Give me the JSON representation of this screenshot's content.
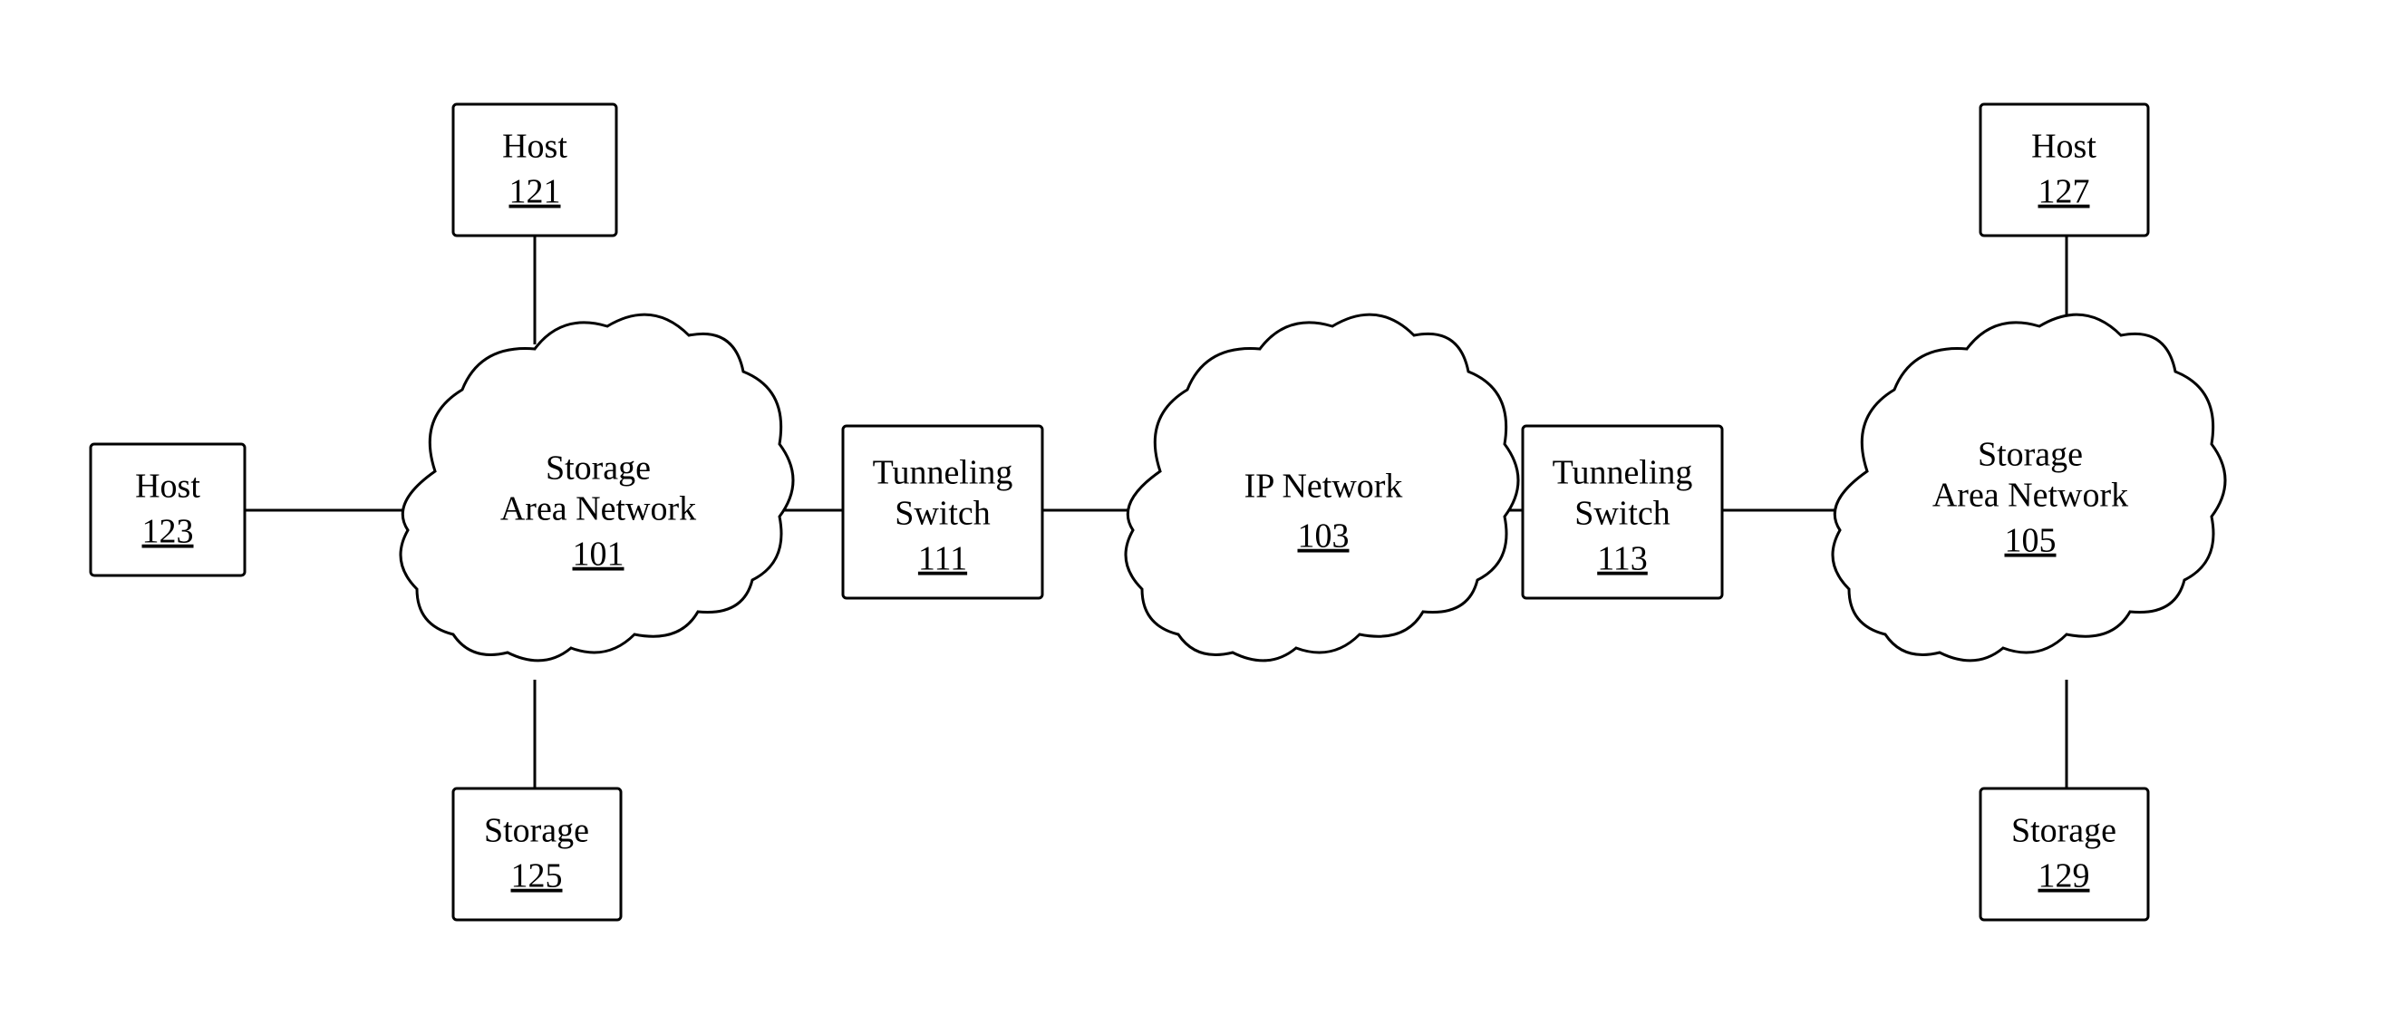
{
  "nodes": {
    "host123": {
      "label": "Host",
      "id": "123",
      "type": "box"
    },
    "host121": {
      "label": "Host",
      "id": "121",
      "type": "box"
    },
    "storage125": {
      "label": "Storage",
      "id": "125",
      "type": "box"
    },
    "san101": {
      "label": "Storage\nArea Network",
      "id": "101",
      "type": "cloud"
    },
    "tunneling111": {
      "label": "Tunneling\nSwitch",
      "id": "111",
      "type": "box"
    },
    "ipnetwork103": {
      "label": "IP Network",
      "id": "103",
      "type": "cloud"
    },
    "tunneling113": {
      "label": "Tunneling\nSwitch",
      "id": "113",
      "type": "box"
    },
    "san105": {
      "label": "Storage\nArea Network",
      "id": "105",
      "type": "cloud"
    },
    "host127": {
      "label": "Host",
      "id": "127",
      "type": "box"
    },
    "storage129": {
      "label": "Storage",
      "id": "129",
      "type": "box"
    }
  }
}
